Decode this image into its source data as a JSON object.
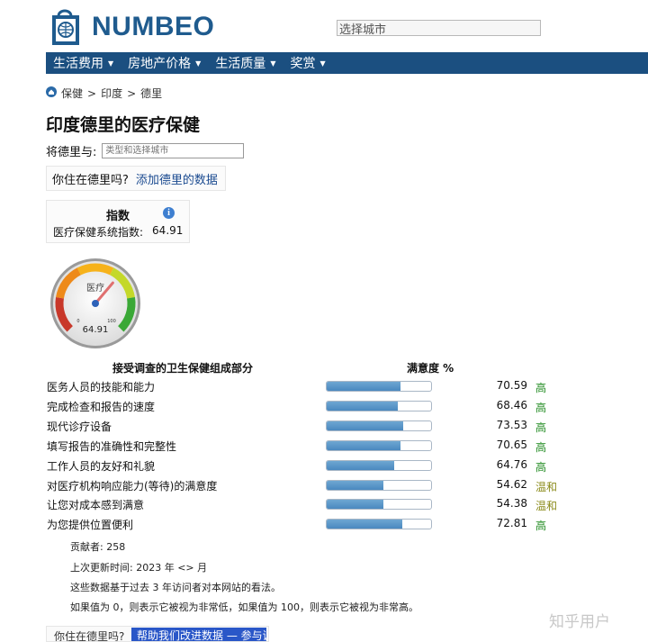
{
  "header": {
    "logo_text": "NUMBEO",
    "search_value": "选择城市"
  },
  "nav": {
    "items": [
      {
        "label": "生活费用"
      },
      {
        "label": "房地产价格"
      },
      {
        "label": "生活质量"
      },
      {
        "label": "奖赏"
      }
    ]
  },
  "breadcrumb": [
    "保健",
    "印度",
    "德里"
  ],
  "page": {
    "title": "印度德里的医疗保健",
    "compare_label": "将德里与:",
    "compare_placeholder": "类型和选择城市",
    "live_question": "你住在德里吗?",
    "live_link": "添加德里的数据"
  },
  "index": {
    "heading": "指数",
    "label": "医疗保健系统指数:",
    "value": "64.91"
  },
  "gauge": {
    "label": "医疗",
    "min": "0",
    "max": "100",
    "value": 64.91,
    "value_text": "64.91"
  },
  "table": {
    "col_component": "接受调查的卫生保健组成部分",
    "col_satisfaction": "满意度 %",
    "rows": [
      {
        "label": "医务人员的技能和能力",
        "value": 70.59,
        "value_text": "70.59",
        "level": "高"
      },
      {
        "label": "完成检查和报告的速度",
        "value": 68.46,
        "value_text": "68.46",
        "level": "高"
      },
      {
        "label": "现代诊疗设备",
        "value": 73.53,
        "value_text": "73.53",
        "level": "高"
      },
      {
        "label": "填写报告的准确性和完整性",
        "value": 70.65,
        "value_text": "70.65",
        "level": "高"
      },
      {
        "label": "工作人员的友好和礼貌",
        "value": 64.76,
        "value_text": "64.76",
        "level": "高"
      },
      {
        "label": "对医疗机构响应能力(等待)的满意度",
        "value": 54.62,
        "value_text": "54.62",
        "level": "温和"
      },
      {
        "label": "让您对成本感到满意",
        "value": 54.38,
        "value_text": "54.38",
        "level": "温和"
      },
      {
        "label": "为您提供位置便利",
        "value": 72.81,
        "value_text": "72.81",
        "level": "高"
      }
    ]
  },
  "notes": {
    "contributors": "贡献者:  258",
    "last_update": "上次更新时间: 2023 年 <> 月",
    "basis": "这些数据基于过去 3 年访问者对本网站的看法。",
    "scale": "如果值为 0，则表示它被视为非常低，如果值为 100，则表示它被视为非常高。"
  },
  "bottom": {
    "question": "你住在德里吗?",
    "button": "帮助我们改进数据 — 参与调查"
  },
  "watermark": "知乎用户"
}
